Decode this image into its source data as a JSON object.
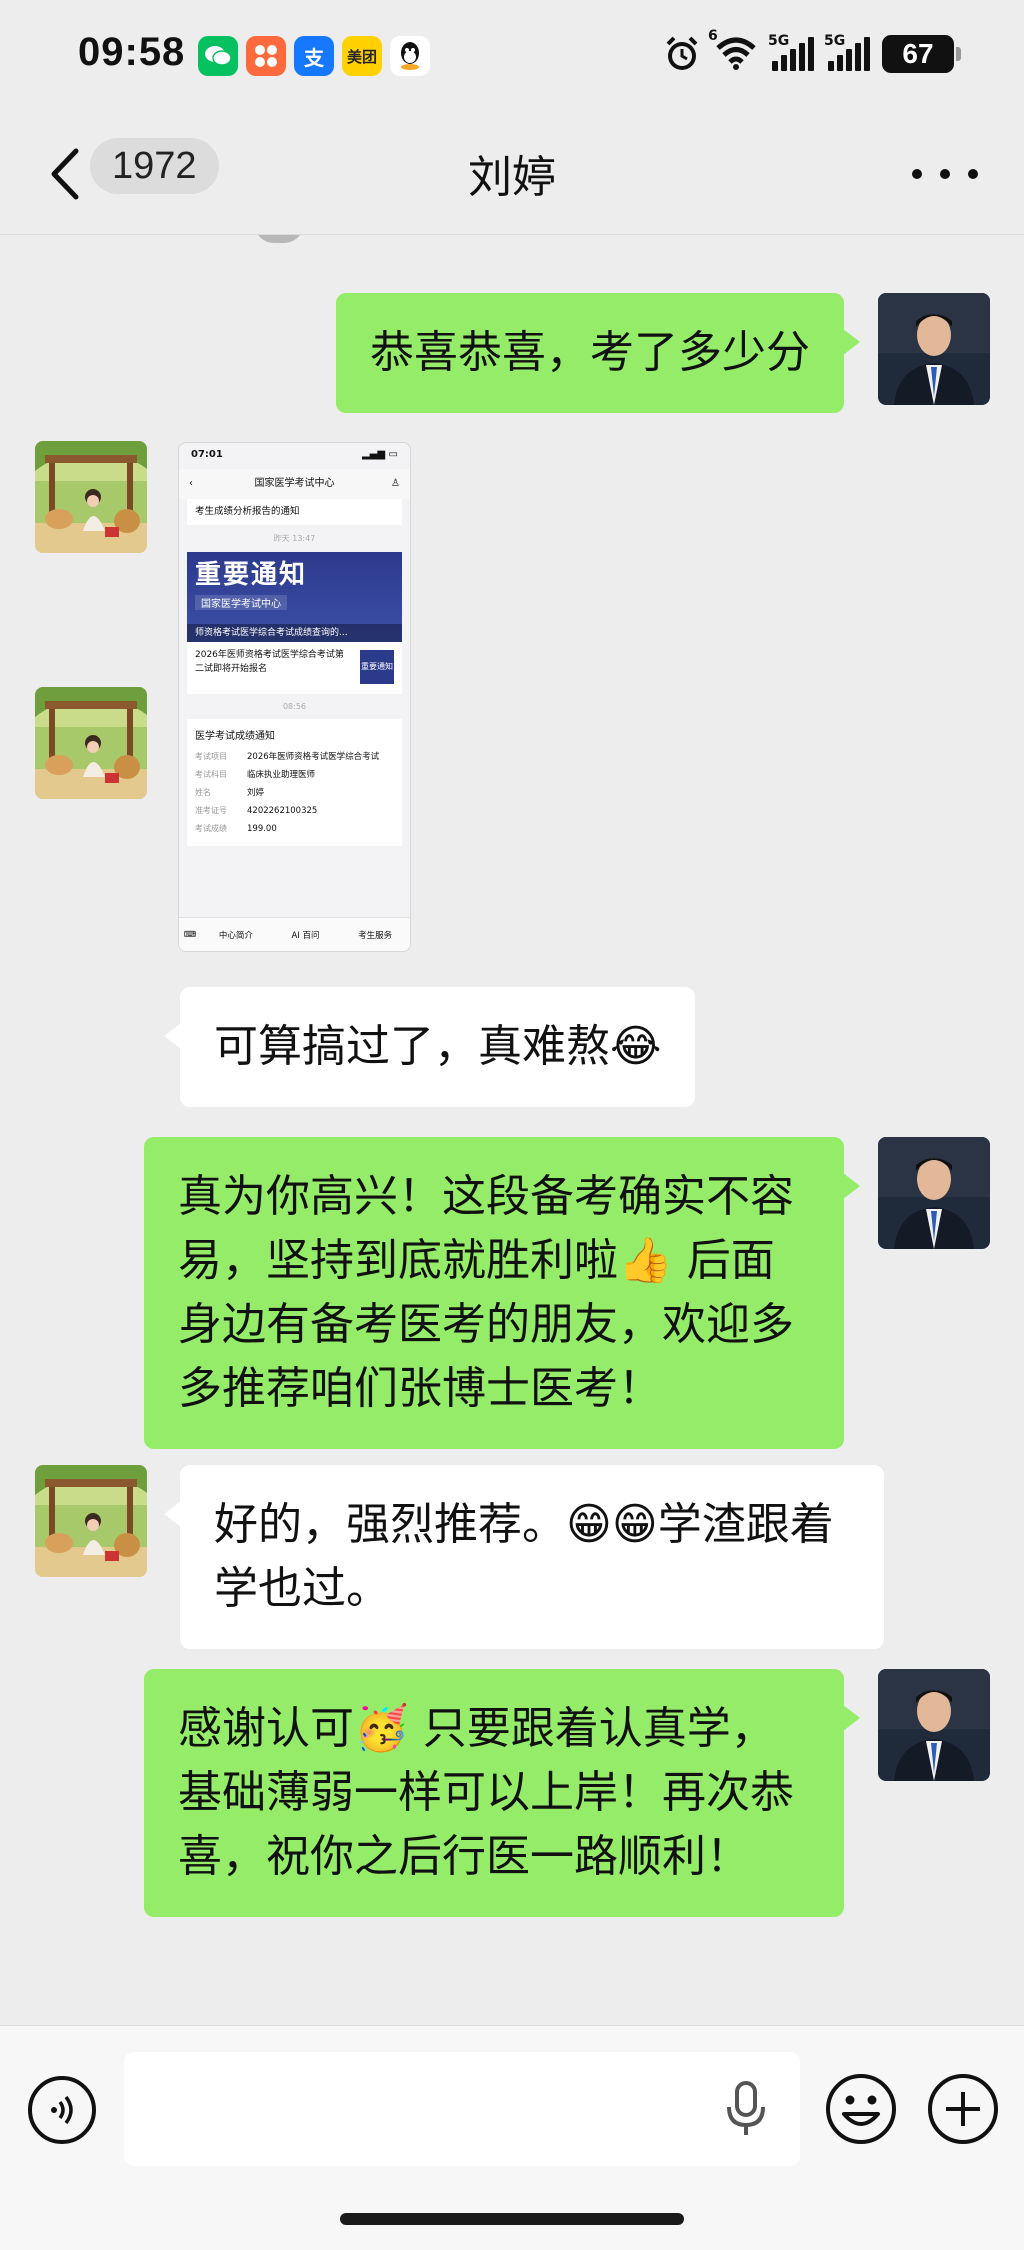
{
  "status_bar": {
    "time": "09:58",
    "app_icons": [
      {
        "name": "wechat-icon",
        "glyph": "◉",
        "color": "#07c160"
      },
      {
        "name": "app-grid-icon",
        "glyph": "✿",
        "color": "#ff6a3d"
      },
      {
        "name": "alipay-icon",
        "glyph": "支",
        "color": "#1677ff"
      },
      {
        "name": "meituan-icon",
        "glyph": "美团",
        "color": "#ffd100"
      },
      {
        "name": "qq-icon",
        "glyph": "🐧",
        "color": "#ffffff"
      }
    ],
    "wifi_label": "6",
    "signal1_label": "5G",
    "signal2_label": "5G",
    "battery": "67"
  },
  "header": {
    "unread_count": "1972",
    "title": "刘婷"
  },
  "messages": [
    {
      "from": "me",
      "text": "恭喜恭喜，考了多少分"
    },
    {
      "from": "other",
      "type": "image"
    },
    {
      "from": "other",
      "text": "可算搞过了，真难熬😂"
    },
    {
      "from": "me",
      "text": "真为你高兴！这段备考确实不容易，坚持到底就胜利啦👍 后面身边有备考医考的朋友，欢迎多多推荐咱们张博士医考！"
    },
    {
      "from": "other",
      "text": "好的，强烈推荐。😁😁学渣跟着学也过。"
    },
    {
      "from": "me",
      "text": "感谢认可🥳 只要跟着认真学，基础薄弱一样可以上岸！再次恭喜，祝你之后行医一路顺利！"
    }
  ],
  "shared_image": {
    "time": "07:01",
    "center_title": "国家医学考试中心",
    "top_card": "考生成绩分析报告的通知",
    "timestamp1": "昨天 13:47",
    "banner_title": "重要通知",
    "banner_sub": "国家医学考试中心",
    "banner_foot": "师资格考试医学综合考试成绩查询的...",
    "item_text": "2026年医师资格考试医学综合考试第二试即将开始报名",
    "item_thumb": "重要通知",
    "timestamp2": "08:56",
    "result_title": "医学考试成绩通知",
    "result_rows": [
      {
        "k": "考试项目",
        "v": "2026年医师资格考试医学综合考试"
      },
      {
        "k": "考试科目",
        "v": "临床执业助理医师"
      },
      {
        "k": "姓名",
        "v": "刘婷"
      },
      {
        "k": "准考证号",
        "v": "420226210032​5"
      },
      {
        "k": "考试成绩",
        "v": "199.00"
      }
    ],
    "tabs": [
      "中心简介",
      "AI 百问",
      "考生服务"
    ]
  },
  "input": {
    "placeholder": ""
  }
}
